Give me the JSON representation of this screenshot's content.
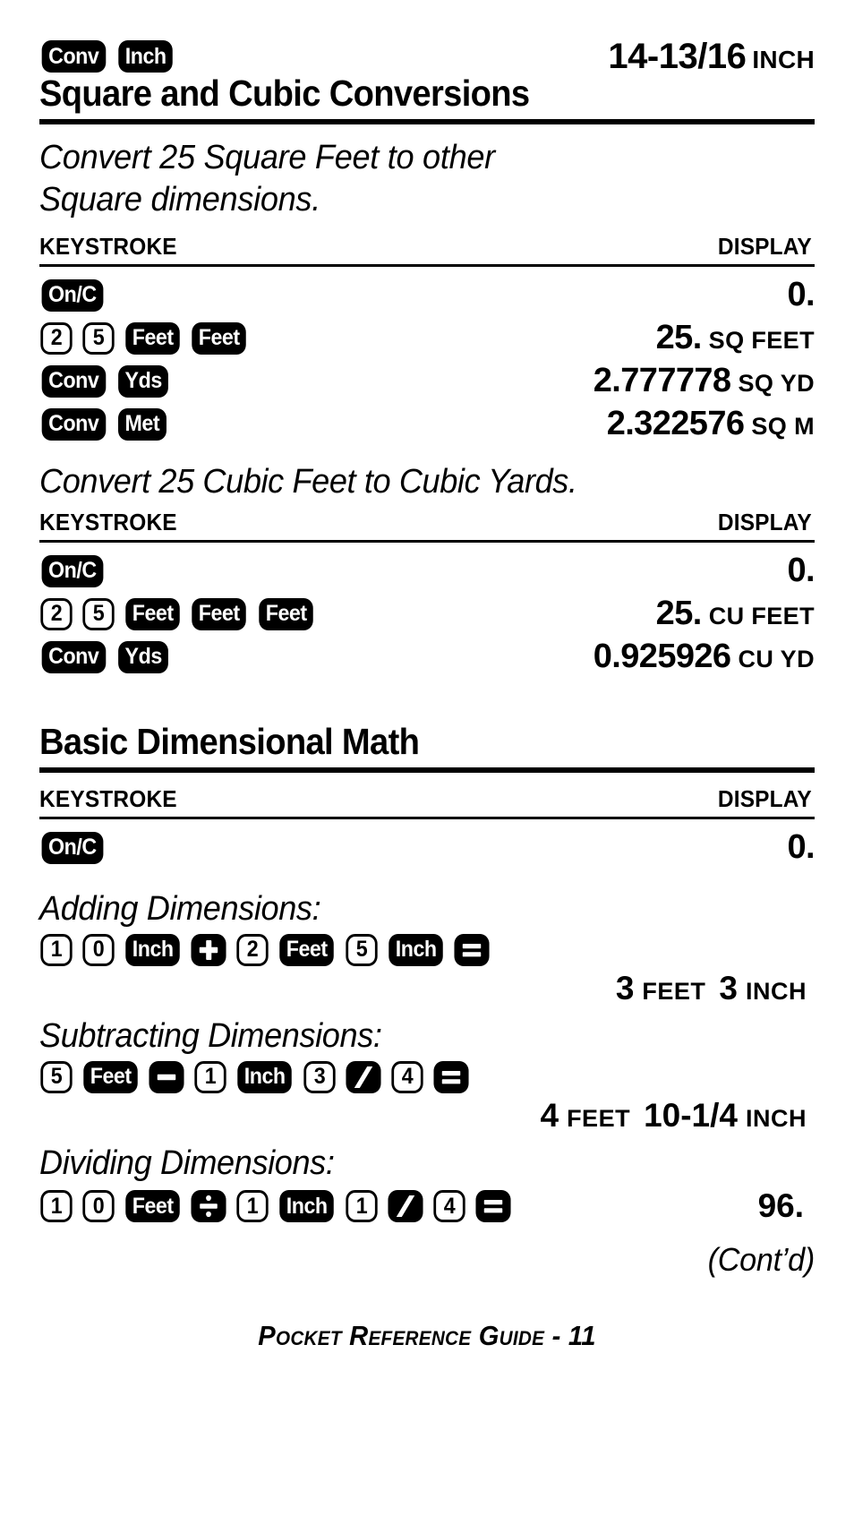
{
  "header": {
    "keys": [
      {
        "label": "Conv",
        "style": "fn"
      },
      {
        "label": "Inch",
        "style": "fn"
      }
    ],
    "display_value": "14-13/16",
    "display_unit": "INCH"
  },
  "section1": {
    "title": "Square and Cubic Conversions",
    "intro_line1": "Convert 25 Square Feet to other",
    "intro_line2": "Square dimensions.",
    "col_keystroke": "KEYSTROKE",
    "col_display": "DISPLAY",
    "rows": [
      {
        "keys": [
          {
            "label": "On/C",
            "style": "fn"
          }
        ],
        "value": "0.",
        "unit": ""
      },
      {
        "keys": [
          {
            "label": "2",
            "style": "num"
          },
          {
            "label": "5",
            "style": "num"
          },
          {
            "label": "Feet",
            "style": "fn"
          },
          {
            "label": "Feet",
            "style": "fn"
          }
        ],
        "value": "25.",
        "unit": "SQ FEET"
      },
      {
        "keys": [
          {
            "label": "Conv",
            "style": "fn"
          },
          {
            "label": "Yds",
            "style": "fn"
          }
        ],
        "value": "2.777778",
        "unit": "SQ YD"
      },
      {
        "keys": [
          {
            "label": "Conv",
            "style": "fn"
          },
          {
            "label": "Met",
            "style": "fn"
          }
        ],
        "value": "2.322576",
        "unit": "SQ M"
      }
    ]
  },
  "section2": {
    "heading": "Convert 25 Cubic Feet to Cubic Yards.",
    "col_keystroke": "KEYSTROKE",
    "col_display": "DISPLAY",
    "rows": [
      {
        "keys": [
          {
            "label": "On/C",
            "style": "fn"
          }
        ],
        "value": "0.",
        "unit": ""
      },
      {
        "keys": [
          {
            "label": "2",
            "style": "num"
          },
          {
            "label": "5",
            "style": "num"
          },
          {
            "label": "Feet",
            "style": "fn"
          },
          {
            "label": "Feet",
            "style": "fn"
          },
          {
            "label": "Feet",
            "style": "fn"
          }
        ],
        "value": "25.",
        "unit": "CU FEET"
      },
      {
        "keys": [
          {
            "label": "Conv",
            "style": "fn"
          },
          {
            "label": "Yds",
            "style": "fn"
          }
        ],
        "value": "0.925926",
        "unit": "CU YD"
      }
    ]
  },
  "section3": {
    "title": "Basic Dimensional Math",
    "col_keystroke": "KEYSTROKE",
    "col_display": "DISPLAY",
    "onc_row": {
      "keys": [
        {
          "label": "On/C",
          "style": "fn"
        }
      ],
      "value": "0.",
      "unit": ""
    },
    "blocks": [
      {
        "label": "Adding Dimensions:",
        "keys": [
          {
            "label": "1",
            "style": "num"
          },
          {
            "label": "0",
            "style": "num"
          },
          {
            "label": "Inch",
            "style": "fn"
          },
          {
            "label": "plus",
            "style": "op",
            "icon": "plus-key-icon"
          },
          {
            "label": "2",
            "style": "num"
          },
          {
            "label": "Feet",
            "style": "fn"
          },
          {
            "label": "5",
            "style": "num"
          },
          {
            "label": "Inch",
            "style": "fn"
          },
          {
            "label": "equals",
            "style": "op",
            "icon": "equals-key-icon"
          }
        ],
        "result_inline": false,
        "result": [
          {
            "value": "3",
            "unit": "FEET"
          },
          {
            "value": "3",
            "unit": "INCH"
          }
        ]
      },
      {
        "label": "Subtracting Dimensions:",
        "keys": [
          {
            "label": "5",
            "style": "num"
          },
          {
            "label": "Feet",
            "style": "fn"
          },
          {
            "label": "minus",
            "style": "op",
            "icon": "minus-key-icon"
          },
          {
            "label": "1",
            "style": "num"
          },
          {
            "label": "Inch",
            "style": "fn"
          },
          {
            "label": "3",
            "style": "num"
          },
          {
            "label": "slash",
            "style": "op",
            "icon": "slash-key-icon"
          },
          {
            "label": "4",
            "style": "num"
          },
          {
            "label": "equals",
            "style": "op",
            "icon": "equals-key-icon"
          }
        ],
        "result_inline": false,
        "result": [
          {
            "value": "4",
            "unit": "FEET"
          },
          {
            "value": "10-1/4",
            "unit": "INCH"
          }
        ]
      },
      {
        "label": "Dividing Dimensions:",
        "keys": [
          {
            "label": "1",
            "style": "num"
          },
          {
            "label": "0",
            "style": "num"
          },
          {
            "label": "Feet",
            "style": "fn"
          },
          {
            "label": "divide",
            "style": "op",
            "icon": "divide-key-icon"
          },
          {
            "label": "1",
            "style": "num"
          },
          {
            "label": "Inch",
            "style": "fn"
          },
          {
            "label": "1",
            "style": "num"
          },
          {
            "label": "slash",
            "style": "op",
            "icon": "slash-key-icon"
          },
          {
            "label": "4",
            "style": "num"
          },
          {
            "label": "equals",
            "style": "op",
            "icon": "equals-key-icon"
          }
        ],
        "result_inline": true,
        "result": [
          {
            "value": "96.",
            "unit": ""
          }
        ]
      }
    ]
  },
  "footer": {
    "contd": "(Cont’d)",
    "page_label": "Pocket Reference Guide - 11"
  }
}
